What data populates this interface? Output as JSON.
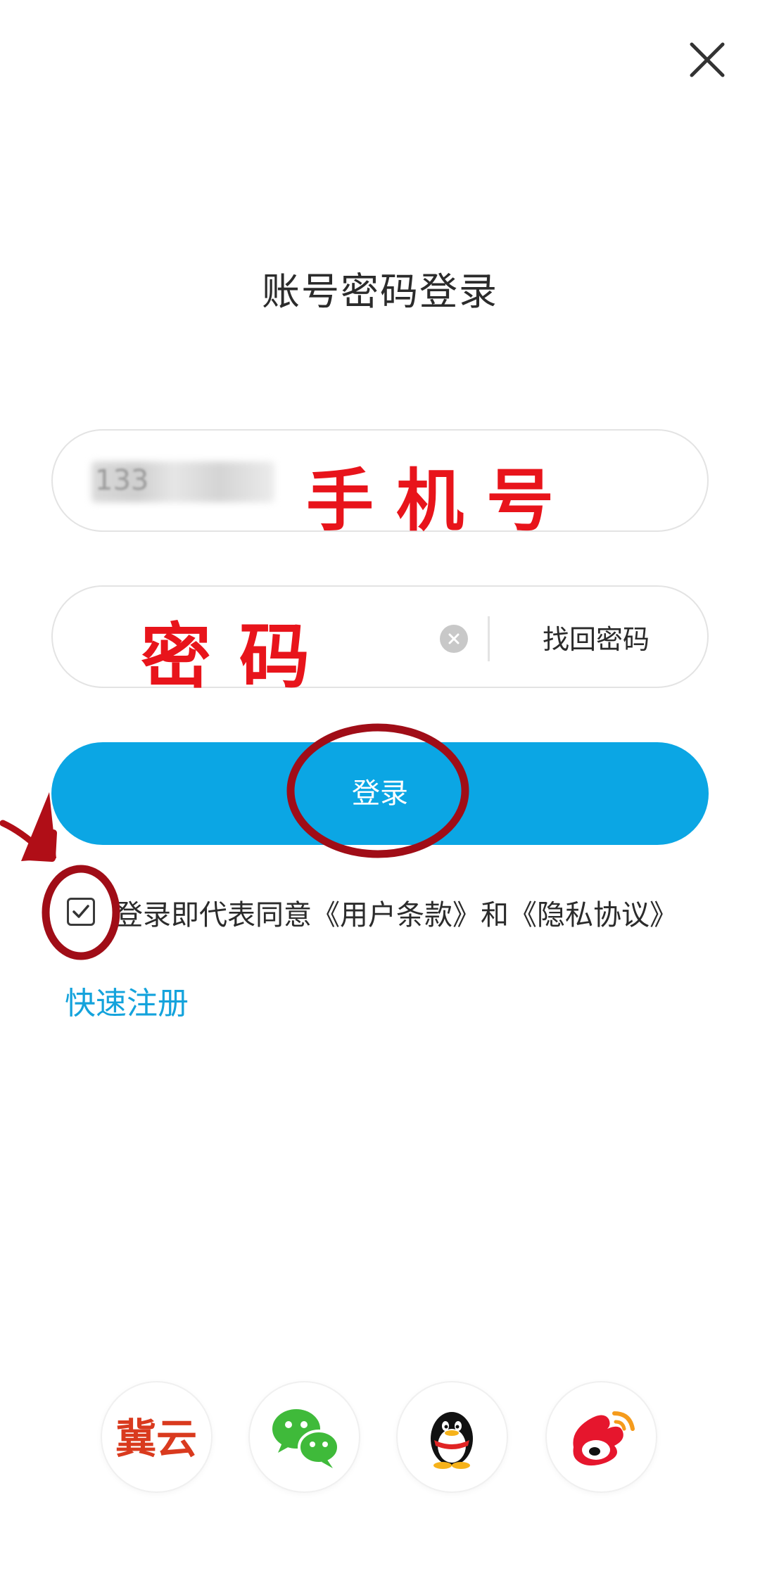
{
  "header": {
    "title": "账号密码登录"
  },
  "phone_field": {
    "value_prefix": "133",
    "annotation": "手机号"
  },
  "password_field": {
    "annotation": "密码",
    "forgot_label": "找回密码"
  },
  "login_button": {
    "label": "登录"
  },
  "agreement": {
    "checked": true,
    "text": "登录即代表同意《用户条款》和《隐私协议》"
  },
  "register_link": {
    "label": "快速注册"
  },
  "social_logins": [
    {
      "name": "jiyun",
      "icon": "jiyun-logo-icon",
      "logo_text": "冀云"
    },
    {
      "name": "wechat",
      "icon": "wechat-icon"
    },
    {
      "name": "qq",
      "icon": "qq-penguin-icon"
    },
    {
      "name": "weibo",
      "icon": "weibo-icon"
    }
  ],
  "colors": {
    "primary": "#0ba6e4",
    "link": "#14a3dc",
    "annotation_red": "#e8141b",
    "annotation_ring": "#a00d17"
  }
}
